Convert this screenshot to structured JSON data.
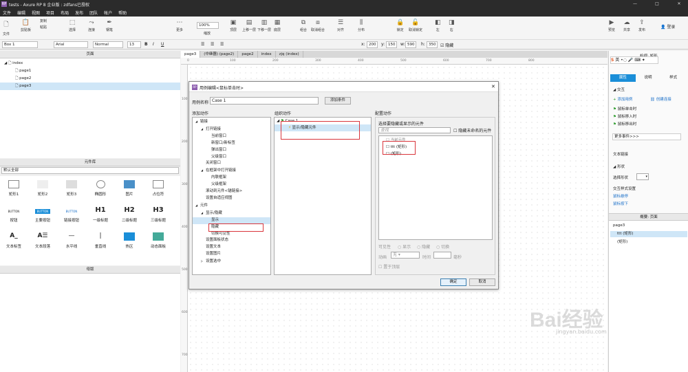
{
  "window": {
    "title": "tests - Axure RP 8 企业版 : zdfans已授权",
    "min": "—",
    "max": "□",
    "close": "✕"
  },
  "menu": [
    "文件",
    "编辑",
    "视图",
    "项目",
    "布局",
    "发布",
    "团队",
    "帐户",
    "帮助"
  ],
  "toolbar": {
    "items": [
      "文件",
      "剪贴板",
      "选择",
      "连接",
      "钢笔",
      "更多",
      "缩放",
      "顶层",
      "上移一层",
      "下移一层",
      "底层",
      "组合",
      "取消组合",
      "对齐",
      "分布",
      "锁定",
      "取消锁定",
      "左",
      "右",
      "预览",
      "共享",
      "发布"
    ],
    "clip": [
      "复制",
      "粘贴"
    ],
    "zoom": "100%",
    "login": "登录"
  },
  "toolbar2": {
    "widget": "Box 1",
    "font": "Arial",
    "style": "Normal",
    "size": "13",
    "x_label": "x:",
    "x": "200",
    "y_label": "y:",
    "y": "150",
    "w_label": "w:",
    "w": "590",
    "h_label": "h:",
    "h": "350",
    "hidden": "隐藏"
  },
  "pages_panel": {
    "title": "页面",
    "root": "index",
    "pages": [
      "page1",
      "page2",
      "page3"
    ]
  },
  "library": {
    "title": "元件库",
    "selector": "默认全部",
    "widgets": [
      "矩形1",
      "矩形2",
      "矩形3",
      "椭圆形",
      "图片",
      "占位符",
      "按钮",
      "主要按钮",
      "链接按钮",
      "一级标题",
      "二级标题",
      "三级标题",
      "文本标签",
      "文本段落",
      "水平线",
      "垂直线",
      "热区",
      "动态面板"
    ],
    "button_text": "BUTTON",
    "h1": "H1",
    "h2": "H2",
    "h3": "H3"
  },
  "masters": {
    "title": "母版"
  },
  "tabs": [
    "page3",
    "(中继器) (page2)",
    "page2",
    "index",
    "zjq (index)"
  ],
  "ruler_h": [
    "0",
    "100",
    "200",
    "300",
    "400",
    "500",
    "600",
    "700",
    "800"
  ],
  "ruler_v": [
    "100",
    "200",
    "300",
    "400",
    "500",
    "600",
    "700"
  ],
  "dialog": {
    "title": "用例编辑<鼠标单击时>",
    "case_name_label": "用例名称",
    "case_name": "Case 1",
    "add_condition": "添加条件",
    "add_action_title": "添加动作",
    "org_action_title": "组织动作",
    "config_action_title": "配置动作",
    "actions": [
      {
        "t": "链接",
        "lvl": 0,
        "tri": "◢"
      },
      {
        "t": "打开链接",
        "lvl": 1,
        "tri": "◢"
      },
      {
        "t": "当前窗口",
        "lvl": 2
      },
      {
        "t": "新窗口/新标签",
        "lvl": 2
      },
      {
        "t": "弹出窗口",
        "lvl": 2
      },
      {
        "t": "父级窗口",
        "lvl": 2
      },
      {
        "t": "关闭窗口",
        "lvl": 1
      },
      {
        "t": "在框架中打开链接",
        "lvl": 1,
        "tri": "◢"
      },
      {
        "t": "内联框架",
        "lvl": 2
      },
      {
        "t": "父级框架",
        "lvl": 2
      },
      {
        "t": "滚动到元件<锚链接>",
        "lvl": 1
      },
      {
        "t": "设置自适应视图",
        "lvl": 1
      },
      {
        "t": "元件",
        "lvl": 0,
        "tri": "◢"
      },
      {
        "t": "显示/隐藏",
        "lvl": 1,
        "tri": "◢"
      },
      {
        "t": "显示",
        "lvl": 2,
        "hl": true
      },
      {
        "t": "隐藏",
        "lvl": 2
      },
      {
        "t": "切换可见性",
        "lvl": 2
      },
      {
        "t": "设置面板状态",
        "lvl": 1
      },
      {
        "t": "设置文本",
        "lvl": 1
      },
      {
        "t": "设置图片",
        "lvl": 1
      },
      {
        "t": "设置选中",
        "lvl": 1,
        "tri": "▷"
      }
    ],
    "case_tree": "Case 1",
    "case_action": "显示/隐藏元件",
    "config_sub": "选择要隐藏或显示的元件",
    "search_placeholder": "查找",
    "hide_unnamed": "隐藏未命名的元件",
    "config_items": [
      "当前元件",
      "ttt (矩形)",
      "(矩形)"
    ],
    "visibility_label": "可见性",
    "vis_opts": [
      "显示",
      "隐藏",
      "切换"
    ],
    "anim_label": "动画",
    "anim_value": "无",
    "time_label": "时间",
    "time_unit": "毫秒",
    "top_label": "置于顶层",
    "ok": "确定",
    "cancel": "取消"
  },
  "right": {
    "header": "检视: 矩形",
    "ime": "英",
    "tabs": [
      "属性",
      "说明",
      "样式"
    ],
    "interaction": "交互",
    "add_case": "添加用例",
    "create_link": "创建连接",
    "events": [
      "鼠标单击时",
      "鼠标移入时",
      "鼠标移出时"
    ],
    "more_events": "更多事件>>>",
    "text_link": "文本链接",
    "shape": "形状",
    "select_shape": "选择形状",
    "interaction_style": "交互样式设置",
    "hover": "鼠标悬停",
    "pressed": "鼠标按下",
    "outline_tabs": [
      "概要: 页面"
    ],
    "outline_page": "page3",
    "outline_items": [
      "ttt (矩形)",
      "(矩形)"
    ]
  },
  "watermark": {
    "text": "Bai经验",
    "url": "jingyan.baidu.com"
  }
}
